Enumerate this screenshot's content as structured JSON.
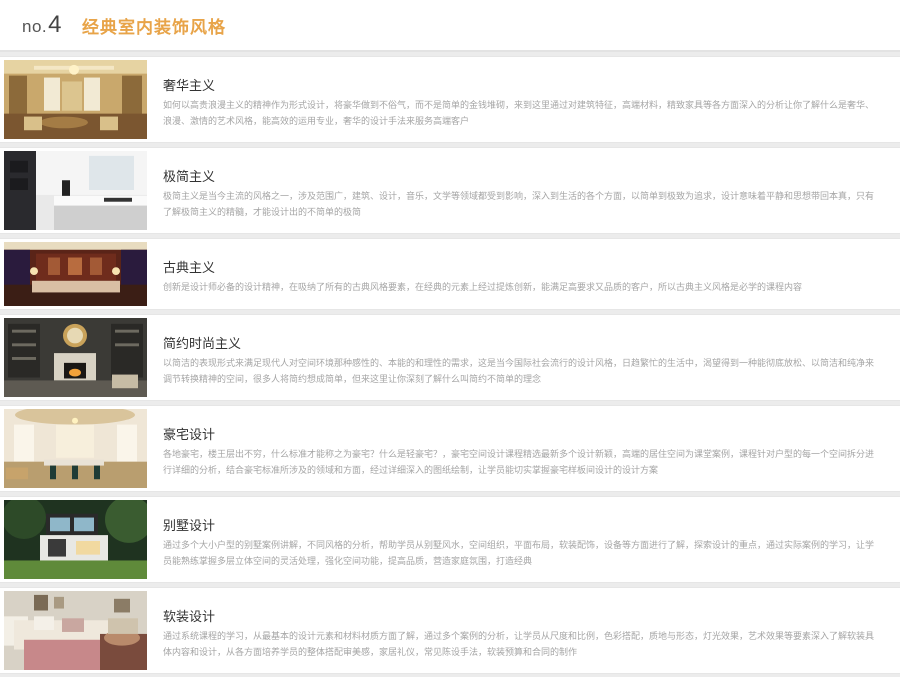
{
  "header": {
    "no_prefix": "no.",
    "no_number": "4",
    "title": "经典室内装饰风格"
  },
  "items": [
    {
      "title": "奢华主义",
      "image": "luxury-interior-photo",
      "desc": "如何以高贵浪漫主义的精神作为形式设计，将豪华做到不俗气，而不是简单的金钱堆砌，来到这里通过对建筑特征，高端材料，精致家具等各方面深入的分析让你了解什么是奢华、浪漫、激情的艺术风格，能高效的运用专业，奢华的设计手法来服务高端客户"
    },
    {
      "title": "极简主义",
      "image": "minimalist-kitchen-photo",
      "desc": "极简主义是当今主流的风格之一，涉及范围广，建筑、设计，音乐，文学等领域都受到影响，深入到生活的各个方面，以简单到极致为追求，设计意味着平静和思想带回本真，只有了解极简主义的精髓，才能设计出的不简单的极简"
    },
    {
      "title": "古典主义",
      "image": "classical-living-room-photo",
      "desc": "创新是设计师必备的设计精神，在吸纳了所有的古典风格要素，在经典的元素上经过提炼创新，能满足高要求又品质的客户，所以古典主义风格是必学的课程内容"
    },
    {
      "title": "简约时尚主义",
      "image": "modern-fashion-interior-photo",
      "desc": "以简洁的表现形式来满足现代人对空间环境那种感性的、本能的和理性的需求，这是当今国际社会流行的设计风格，日趋繁忙的生活中，渴望得到一种能彻底放松、以简洁和纯净来调节转换精神的空间，很多人将简约想成简单，但来这里让你深刻了解什么叫简约不简单的理念"
    },
    {
      "title": "豪宅设计",
      "image": "mansion-dining-hall-photo",
      "desc": "各地豪宅，楼王层出不穷，什么标准才能称之为豪宅？什么是轻豪宅？，豪宅空间设计课程精选最新多个设计新颖，高端的居住空间为课堂案例，课程针对户型的每一个空间拆分进行详细的分析，结合豪宅标准所涉及的领域和方面，经过详细深入的图纸绘制，让学员能切实掌握豪宅样板间设计的设计方案"
    },
    {
      "title": "别墅设计",
      "image": "villa-exterior-photo",
      "desc": "通过多个大小户型的别墅案例讲解，不同风格的分析，帮助学员从别墅风水，空间组织，平面布局，软装配饰，设备等方面进行了解，探索设计的重点，通过实际案例的学习，让学员能熟练掌握多层立体空间的灵活处理，强化空间功能，提高品质，营造家庭氛围，打造经典"
    },
    {
      "title": "软装设计",
      "image": "soft-furnishing-bedroom-photo",
      "desc": "通过系统课程的学习，从最基本的设计元素和材料材质方面了解，通过多个案例的分析，让学员从尺度和比例，色彩搭配，质地与形态，灯光效果，艺术效果等要素深入了解软装具体内容和设计，从各方面培养学员的整体搭配审美感，家居礼仪，常见陈设手法，软装预算和合同的制作"
    }
  ]
}
